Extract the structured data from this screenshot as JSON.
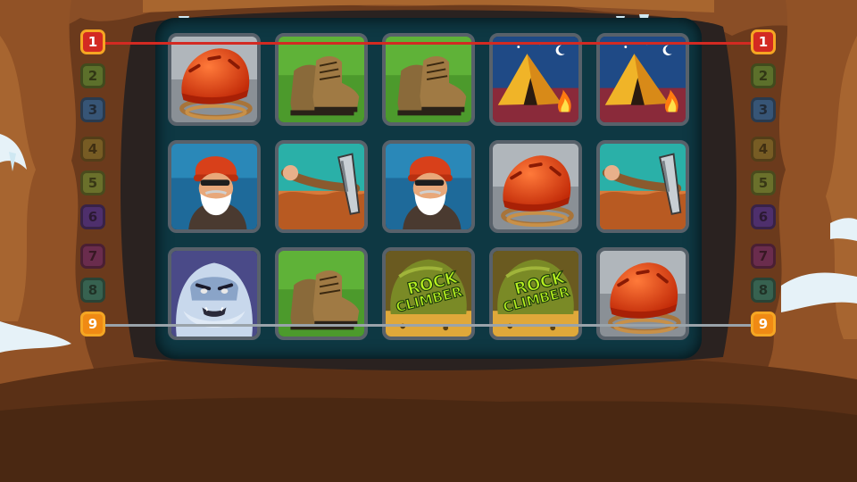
{
  "game": {
    "left_markers": [
      {
        "label": "1",
        "color": "#d32a22",
        "active": true
      },
      {
        "label": "2",
        "color": "#5a7a2e",
        "active": false
      },
      {
        "label": "3",
        "color": "#2e5a86",
        "active": false
      },
      {
        "label": "4",
        "color": "#7a6226",
        "active": false
      },
      {
        "label": "5",
        "color": "#6a7a2e",
        "active": false
      },
      {
        "label": "6",
        "color": "#4a2e7a",
        "active": false
      },
      {
        "label": "7",
        "color": "#6a2a56",
        "active": false
      },
      {
        "label": "8",
        "color": "#2e6a5a",
        "active": false
      },
      {
        "label": "9",
        "color": "#f08a14",
        "active": true
      }
    ],
    "right_markers": [
      {
        "label": "1",
        "color": "#d32a22",
        "active": true
      },
      {
        "label": "2",
        "color": "#5a7a2e",
        "active": false
      },
      {
        "label": "3",
        "color": "#2e5a86",
        "active": false
      },
      {
        "label": "4",
        "color": "#7a6226",
        "active": false
      },
      {
        "label": "5",
        "color": "#6a7a2e",
        "active": false
      },
      {
        "label": "6",
        "color": "#4a2e7a",
        "active": false
      },
      {
        "label": "7",
        "color": "#6a2a56",
        "active": false
      },
      {
        "label": "8",
        "color": "#2e6a5a",
        "active": false
      },
      {
        "label": "9",
        "color": "#f08a14",
        "active": true
      }
    ],
    "paylines": [
      {
        "line": "1",
        "color": "#d32a22"
      },
      {
        "line": "9",
        "color": "#9aa3aa"
      }
    ],
    "reels": [
      [
        "helmet",
        "boots",
        "boots",
        "tent",
        "tent"
      ],
      [
        "climber",
        "icepick",
        "climber",
        "helmet",
        "icepick"
      ],
      [
        "yeti",
        "boots",
        "rock",
        "rock",
        "helmet"
      ]
    ],
    "rock_logo": {
      "line1": "ROCK",
      "line2": "CLIMBER"
    }
  }
}
